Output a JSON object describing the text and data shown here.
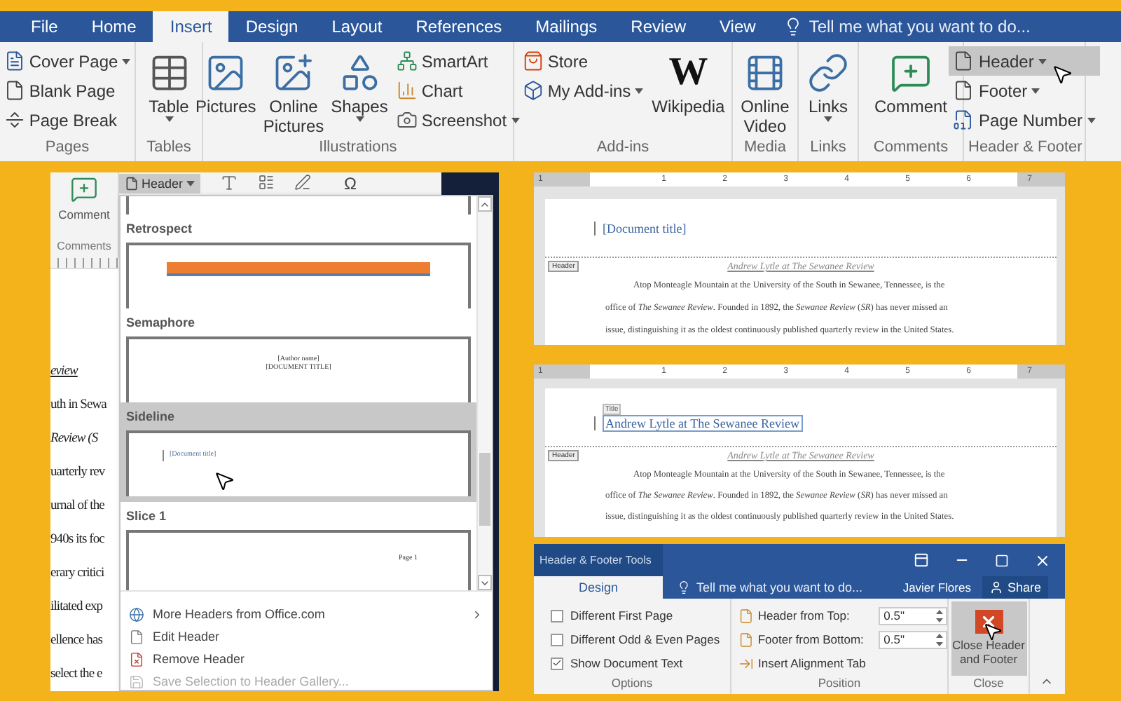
{
  "ribbon": {
    "tabs": [
      {
        "label": "File",
        "selected": false
      },
      {
        "label": "Home",
        "selected": false
      },
      {
        "label": "Insert",
        "selected": true
      },
      {
        "label": "Design",
        "selected": false
      },
      {
        "label": "Layout",
        "selected": false
      },
      {
        "label": "References",
        "selected": false
      },
      {
        "label": "Mailings",
        "selected": false
      },
      {
        "label": "Review",
        "selected": false
      },
      {
        "label": "View",
        "selected": false
      }
    ],
    "tell_me": "Tell me what you want to do...",
    "groups": [
      {
        "label": "Pages",
        "items": [
          {
            "kind": "small",
            "label": "Cover Page",
            "dropdown": true,
            "highlighted": false
          },
          {
            "kind": "small",
            "label": "Blank Page",
            "dropdown": false,
            "highlighted": false
          },
          {
            "kind": "small",
            "label": "Page Break",
            "dropdown": false,
            "highlighted": false
          }
        ]
      },
      {
        "label": "Tables",
        "items": [
          {
            "kind": "large",
            "label": "Table",
            "dropdown": true,
            "highlighted": false
          }
        ]
      },
      {
        "label": "Illustrations",
        "items": [
          {
            "kind": "large",
            "label": "Pictures",
            "dropdown": false,
            "highlighted": false
          },
          {
            "kind": "large",
            "label": "Online Pictures",
            "dropdown": false,
            "highlighted": false
          },
          {
            "kind": "large",
            "label": "Shapes",
            "dropdown": true,
            "highlighted": false
          },
          {
            "kind": "small",
            "label": "SmartArt",
            "dropdown": false,
            "highlighted": false
          },
          {
            "kind": "small",
            "label": "Chart",
            "dropdown": false,
            "highlighted": false
          },
          {
            "kind": "small",
            "label": "Screenshot",
            "dropdown": true,
            "highlighted": false
          }
        ]
      },
      {
        "label": "Add-ins",
        "items": [
          {
            "kind": "small",
            "label": "Store",
            "dropdown": false,
            "highlighted": false
          },
          {
            "kind": "small",
            "label": "My Add-ins",
            "dropdown": true,
            "highlighted": false
          },
          {
            "kind": "large",
            "label": "Wikipedia",
            "glyph": "W",
            "dropdown": false,
            "highlighted": false
          }
        ]
      },
      {
        "label": "Media",
        "items": [
          {
            "kind": "large",
            "label": "Online Video",
            "dropdown": false,
            "highlighted": false
          }
        ]
      },
      {
        "label": "Links",
        "items": [
          {
            "kind": "large",
            "label": "Links",
            "dropdown": true,
            "highlighted": false
          }
        ]
      },
      {
        "label": "Comments",
        "items": [
          {
            "kind": "large",
            "label": "Comment",
            "dropdown": false,
            "highlighted": false
          }
        ]
      },
      {
        "label": "Header & Footer",
        "items": [
          {
            "kind": "small",
            "label": "Header",
            "dropdown": true,
            "highlighted": true
          },
          {
            "kind": "small",
            "label": "Footer",
            "dropdown": true,
            "highlighted": false
          },
          {
            "kind": "small",
            "label": "Page Number",
            "dropdown": true,
            "highlighted": false
          }
        ]
      }
    ]
  },
  "gallery_window": {
    "comment_button": "Comment",
    "comments_label": "Comments",
    "header_button": "Header",
    "symbol": "Ω",
    "document_lines": [
      {
        "kind": "title",
        "text": "eview"
      },
      {
        "kind": "plain",
        "text": "uth in Sewa"
      },
      {
        "kind": "italic",
        "text": "Review (S"
      },
      {
        "kind": "plain",
        "text": "uarterly rev"
      },
      {
        "kind": "plain",
        "text": "urnal of the"
      },
      {
        "kind": "plain",
        "text": "940s its foc"
      },
      {
        "kind": "plain",
        "text": "erary critici"
      },
      {
        "kind": "plain",
        "text": "ilitated exp"
      },
      {
        "kind": "plain",
        "text": "ellence has"
      },
      {
        "kind": "plain",
        "text": "select the e"
      }
    ],
    "gallery": {
      "sections": [
        {
          "name": "Retrospect",
          "selected": false,
          "preview": {
            "kind": "banner"
          }
        },
        {
          "name": "Semaphore",
          "selected": false,
          "preview": {
            "kind": "centered",
            "texts": [
              "[Author name]",
              "[DOCUMENT TITLE]"
            ]
          }
        },
        {
          "name": "Sideline",
          "selected": true,
          "preview": {
            "kind": "sideline",
            "texts": [
              "[Document title]"
            ]
          }
        },
        {
          "name": "Slice 1",
          "selected": false,
          "preview": {
            "kind": "right",
            "texts": [
              "Page 1"
            ]
          }
        }
      ]
    },
    "menu": [
      {
        "label": "More Headers from Office.com",
        "submenu": true,
        "disabled": false
      },
      {
        "label": "Edit Header",
        "submenu": false,
        "disabled": false
      },
      {
        "label": "Remove Header",
        "submenu": false,
        "disabled": false
      },
      {
        "label": "Save Selection to Header Gallery...",
        "submenu": false,
        "disabled": true
      }
    ]
  },
  "header_previews": [
    {
      "kind": "placeholder",
      "ruler": [
        "1",
        "1",
        "2",
        "3",
        "4",
        "5",
        "6",
        "7"
      ],
      "header_text": "[Document title]",
      "header_tag": "Header",
      "running_head": "Andrew Lytle at The Sewanee Review",
      "body_lines": [
        "Atop Monteagle Mountain at the University of the South in Sewanee, Tennessee, is the",
        "office of *The Sewanee Review*. Founded in 1892, the *Sewanee Review* (*SR*) has never missed an",
        "issue, distinguishing it as the oldest continuously published quarterly review in the United States."
      ]
    },
    {
      "kind": "editing",
      "ruler": [
        "1",
        "1",
        "2",
        "3",
        "4",
        "5",
        "6",
        "7"
      ],
      "field_tag": "Title",
      "header_text": "Andrew Lytle at The Sewanee Review",
      "header_tag": "Header",
      "running_head": "Andrew Lytle at The Sewanee Review",
      "body_lines": [
        "Atop Monteagle Mountain at the University of the South in Sewanee, Tennessee, is the",
        "office of *The Sewanee Review*. Founded in 1892, the *Sewanee Review* (*SR*) has never missed an",
        "issue, distinguishing it as the oldest continuously published quarterly review in the United States."
      ]
    }
  ],
  "tools_window": {
    "context_title": "Header & Footer Tools",
    "tabs": [
      {
        "label": "Design",
        "selected": true
      }
    ],
    "tell_me": "Tell me what you want to do...",
    "user": "Javier Flores",
    "share_button": "Share",
    "options_group": {
      "label": "Options",
      "checkboxes": [
        {
          "label": "Different First Page",
          "checked": false
        },
        {
          "label": "Different Odd & Even Pages",
          "checked": false
        },
        {
          "label": "Show Document Text",
          "checked": true
        }
      ]
    },
    "position_group": {
      "label": "Position",
      "items": [
        {
          "kind": "spinner",
          "label": "Header from Top:",
          "value": "0.5\""
        },
        {
          "kind": "spinner",
          "label": "Footer from Bottom:",
          "value": "0.5\""
        },
        {
          "kind": "button",
          "label": "Insert Alignment Tab"
        }
      ]
    },
    "close_group": {
      "label": "Close",
      "button": {
        "label": "Close Header and Footer",
        "highlighted": true
      }
    }
  }
}
